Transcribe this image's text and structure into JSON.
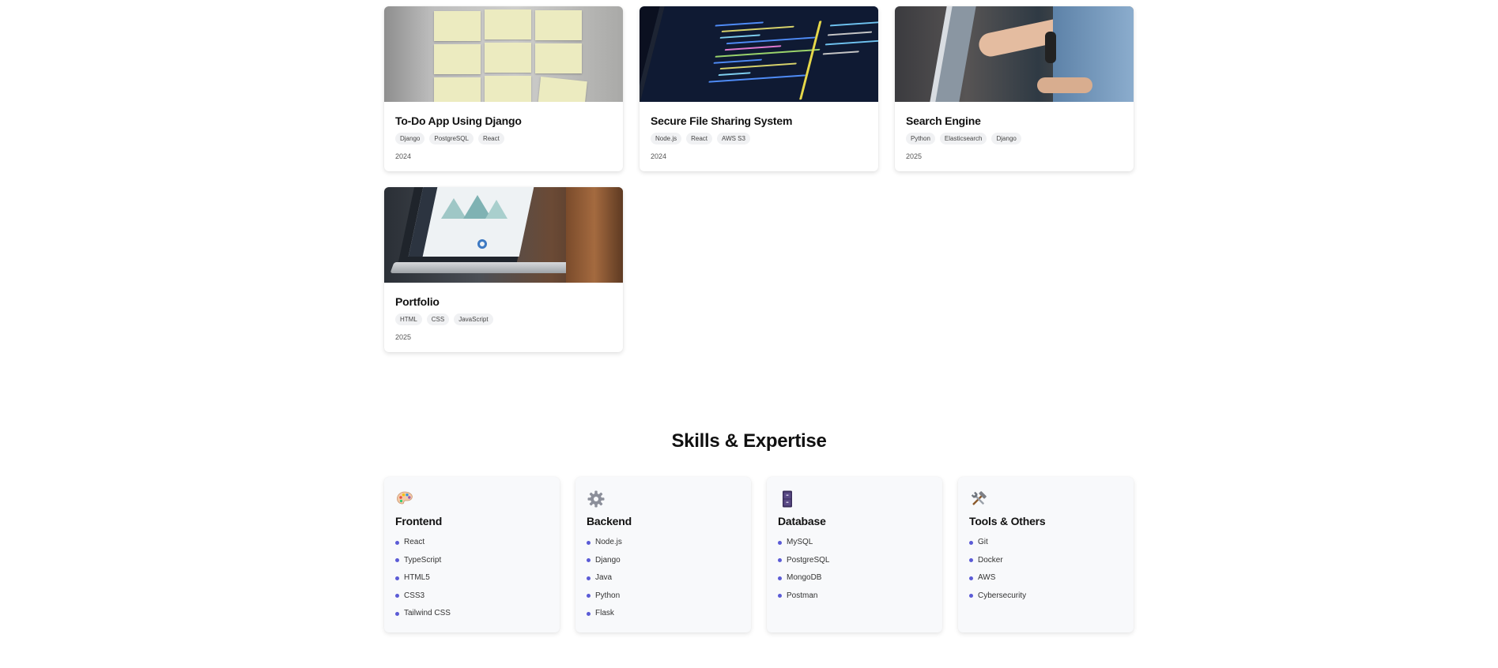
{
  "projects": [
    {
      "title": "To-Do App Using Django",
      "tags": [
        "Django",
        "PostgreSQL",
        "React"
      ],
      "year": "2024",
      "image": "sticky-notes-photo"
    },
    {
      "title": "Secure File Sharing System",
      "tags": [
        "Node.js",
        "React",
        "AWS S3"
      ],
      "year": "2024",
      "image": "code-on-monitor-photo"
    },
    {
      "title": "Search Engine",
      "tags": [
        "Python",
        "Elasticsearch",
        "Django"
      ],
      "year": "2025",
      "image": "pointing-at-screen-photo"
    },
    {
      "title": "Portfolio",
      "tags": [
        "HTML",
        "CSS",
        "JavaScript"
      ],
      "year": "2025",
      "image": "laptop-dashboard-photo"
    }
  ],
  "skills_section": {
    "title": "Skills & Expertise",
    "categories": [
      {
        "title": "Frontend",
        "icon": "palette-icon",
        "items": [
          "React",
          "TypeScript",
          "HTML5",
          "CSS3",
          "Tailwind CSS"
        ]
      },
      {
        "title": "Backend",
        "icon": "gear-icon",
        "items": [
          "Node.js",
          "Django",
          "Java",
          "Python",
          "Flask"
        ]
      },
      {
        "title": "Database",
        "icon": "file-cabinet-icon",
        "items": [
          "MySQL",
          "PostgreSQL",
          "MongoDB",
          "Postman"
        ]
      },
      {
        "title": "Tools & Others",
        "icon": "hammer-wrench-icon",
        "items": [
          "Git",
          "Docker",
          "AWS",
          "Cybersecurity"
        ]
      }
    ]
  },
  "colors": {
    "bullet": "#5b5bd6",
    "tag_bg": "#f0f1f3",
    "skill_card_bg": "#f8f9fb"
  }
}
